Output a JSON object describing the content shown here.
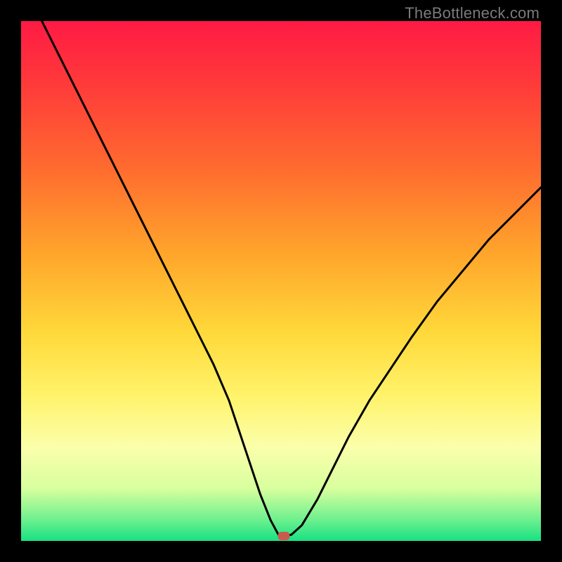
{
  "watermark": "TheBottleneck.com",
  "colors": {
    "frame": "#000000",
    "gradient_top": "#ff1a44",
    "gradient_bottom": "#17e183",
    "curve": "#000000",
    "marker": "#c95a4e"
  },
  "chart_data": {
    "type": "line",
    "title": "",
    "xlabel": "",
    "ylabel": "",
    "xlim": [
      0,
      100
    ],
    "ylim": [
      0,
      100
    ],
    "grid": false,
    "series": [
      {
        "name": "bottleneck-curve",
        "x": [
          4,
          7,
          10,
          13,
          16,
          19,
          22,
          25,
          28,
          31,
          34,
          37,
          40,
          42,
          44,
          46,
          48,
          49.5,
          50,
          51,
          52,
          54,
          57,
          60,
          63,
          67,
          71,
          75,
          80,
          85,
          90,
          95,
          100
        ],
        "values": [
          100,
          94,
          88,
          82,
          76,
          70,
          64,
          58,
          52,
          46,
          40,
          34,
          27,
          21,
          15,
          9,
          4,
          1.2,
          1,
          1,
          1.2,
          3,
          8,
          14,
          20,
          27,
          33,
          39,
          46,
          52,
          58,
          63,
          68
        ]
      }
    ],
    "marker": {
      "x": 50.5,
      "y": 1
    }
  }
}
